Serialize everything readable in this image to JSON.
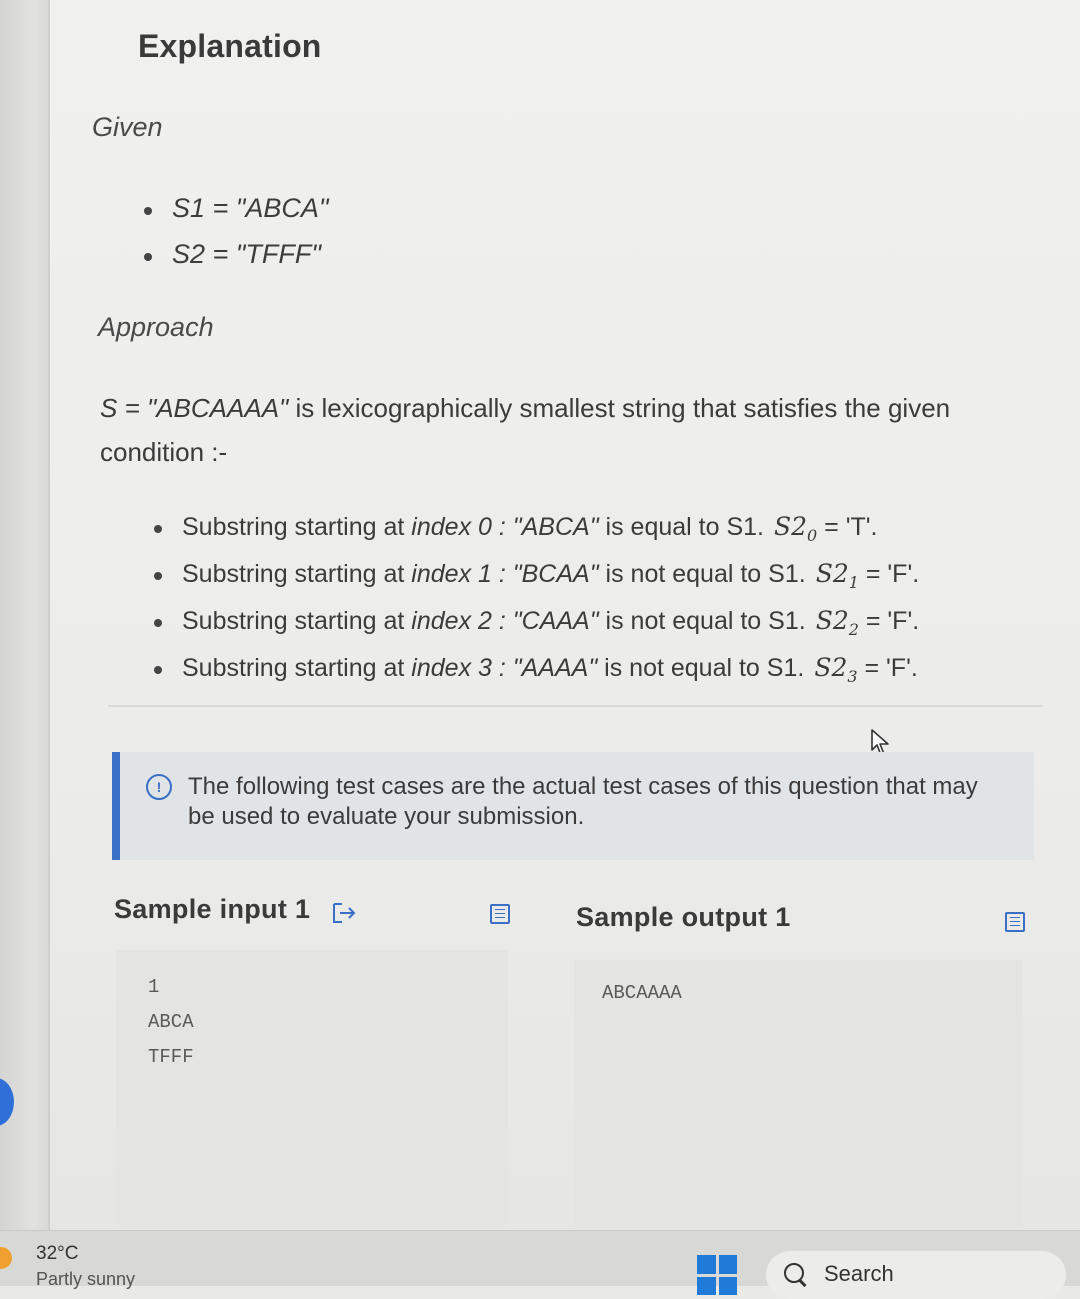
{
  "explanation": {
    "title": "Explanation",
    "given_label": "Given",
    "given_items": [
      "S1 = \"ABCA\"",
      "S2 = \"TFFF\""
    ],
    "approach_label": "Approach",
    "approach_text_prefix": "S = \"ABCAAAA\"",
    "approach_text_rest": " is lexicographically smallest string that satisfies the given condition :-",
    "substring_items": [
      {
        "lead": "Substring starting at ",
        "index": "index 0",
        "quoted": " : \"ABCA\"",
        "rest": " is equal to S1.",
        "math": "S2",
        "sub": "0",
        "result": " = 'T'."
      },
      {
        "lead": "Substring starting at ",
        "index": "index 1",
        "quoted": " : \"BCAA\"",
        "rest": " is not equal to S1.",
        "math": "S2",
        "sub": "1",
        "result": " = 'F'."
      },
      {
        "lead": "Substring starting at ",
        "index": "index 2",
        "quoted": " : \"CAAA\"",
        "rest": " is not equal to S1.",
        "math": "S2",
        "sub": "2",
        "result": " = 'F'."
      },
      {
        "lead": "Substring starting at ",
        "index": "index 3",
        "quoted": " : \"AAAA\"",
        "rest": " is not equal to S1.",
        "math": "S2",
        "sub": "3",
        "result": " = 'F'."
      }
    ]
  },
  "notice": {
    "icon": "info-icon",
    "text": "The following test cases are the actual test cases of this question that may be used to evaluate your submission."
  },
  "sample_input": {
    "title": "Sample input 1",
    "lines": [
      "1",
      "ABCA",
      "TFFF"
    ]
  },
  "sample_output": {
    "title": "Sample output 1",
    "lines": [
      "ABCAAAA"
    ]
  },
  "taskbar": {
    "temperature": "32°C",
    "weather": "Partly sunny",
    "search_label": "Search"
  },
  "colors": {
    "accent": "#3a6fc6",
    "windows_blue": "#1f7ad8"
  }
}
